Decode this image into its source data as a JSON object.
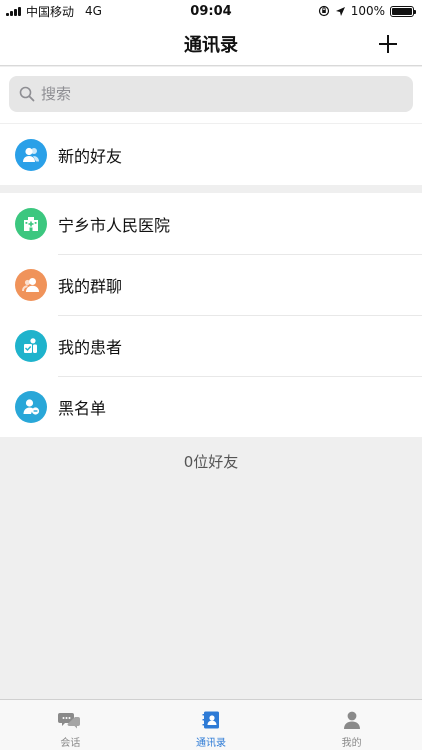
{
  "status_bar": {
    "carrier": "中国移动",
    "network": "4G",
    "time": "09:04",
    "battery": "100%"
  },
  "nav": {
    "title": "通讯录",
    "add_icon": "plus-icon"
  },
  "search": {
    "placeholder": "搜索",
    "value": ""
  },
  "top_items": [
    {
      "label": "新的好友",
      "icon": "new-friend-icon",
      "color": "#2aa0e8"
    }
  ],
  "groups": [
    {
      "label": "宁乡市人民医院",
      "icon": "hospital-icon",
      "color": "#3cc77f"
    },
    {
      "label": "我的群聊",
      "icon": "group-chat-icon",
      "color": "#f0935a"
    },
    {
      "label": "我的患者",
      "icon": "patient-icon",
      "color": "#1fb3cc"
    },
    {
      "label": "黑名单",
      "icon": "blacklist-icon",
      "color": "#29a7d8"
    }
  ],
  "footer_note": "0位好友",
  "tabbar": {
    "items": [
      {
        "label": "会话",
        "icon": "chat-icon",
        "active": false
      },
      {
        "label": "通讯录",
        "icon": "contacts-icon",
        "active": true
      },
      {
        "label": "我的",
        "icon": "profile-icon",
        "active": false
      }
    ],
    "active_color": "#2e7bd6",
    "inactive_color": "#8a8a8a"
  }
}
